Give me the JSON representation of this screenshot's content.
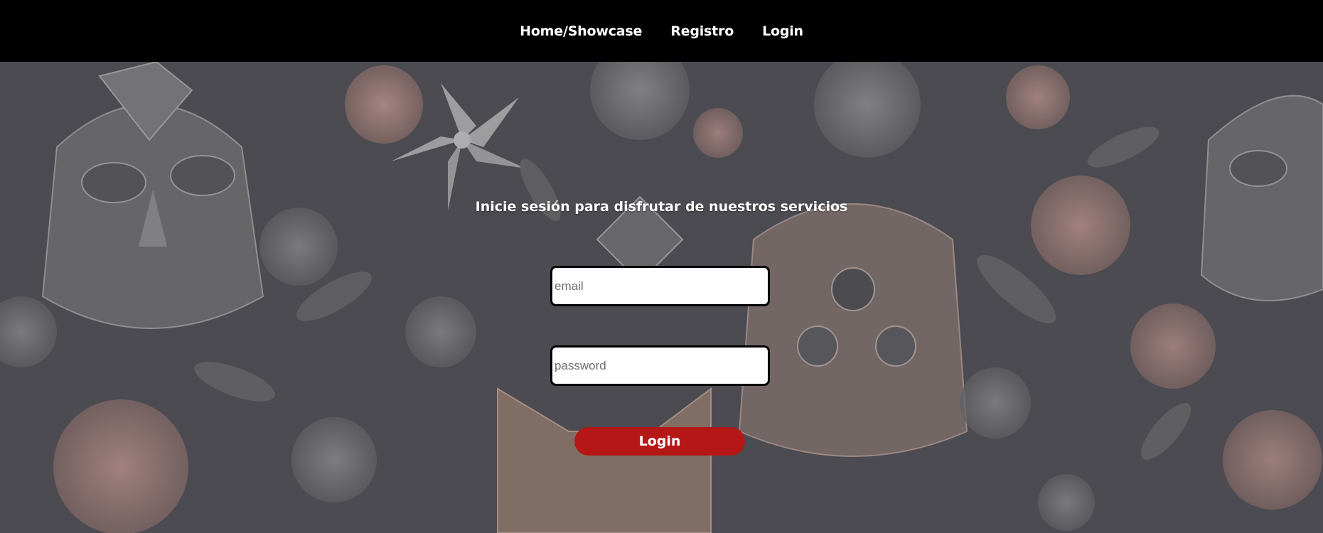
{
  "nav": {
    "items": [
      {
        "label": "Home/Showcase"
      },
      {
        "label": "Registro"
      },
      {
        "label": "Login"
      }
    ]
  },
  "form": {
    "subtitle": "Inicie sesión para disfrutar de nuestros servicios",
    "email_placeholder": "email",
    "email_value": "",
    "password_placeholder": "password",
    "password_value": "",
    "submit_label": "Login"
  },
  "colors": {
    "navbar": "#000000",
    "background": "#4a4a50",
    "button": "#b51717",
    "text": "#ffffff"
  }
}
